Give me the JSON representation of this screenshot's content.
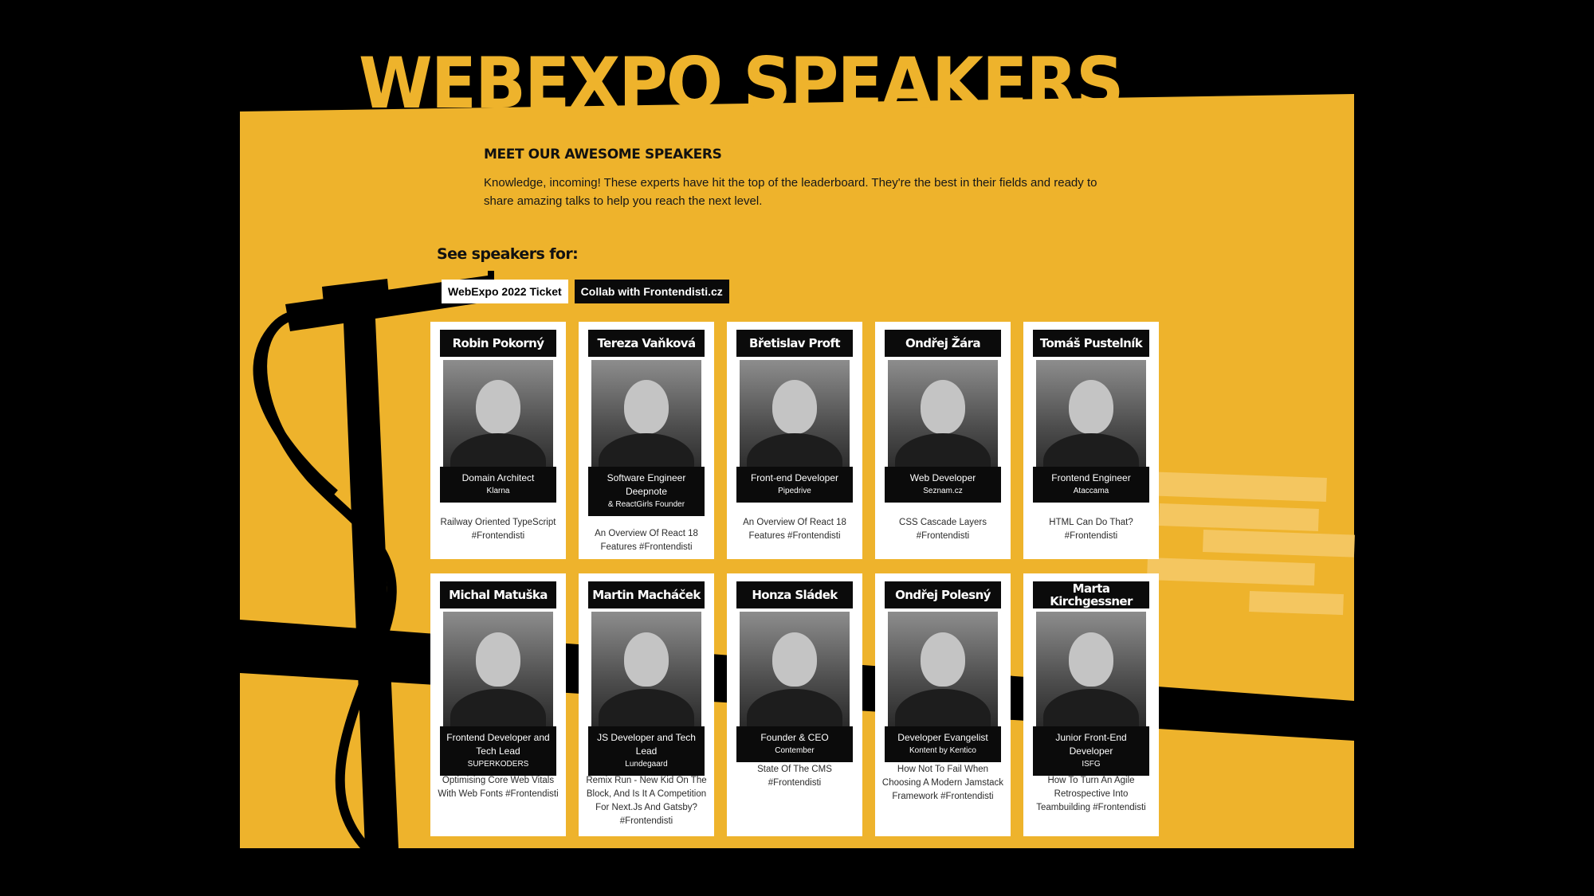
{
  "page": {
    "title": "WEBEXPO SPEAKERS"
  },
  "intro": {
    "heading": "MEET OUR AWESOME SPEAKERS",
    "text": "Knowledge, incoming! These experts have hit the top of the leaderboard. They're the best in their fields and ready to share amazing talks to help you reach the next level."
  },
  "filter": {
    "label": "See speakers for:",
    "tabs": [
      {
        "label": "WebExpo 2022 Ticket",
        "active": true
      },
      {
        "label": "Collab with Frontendisti.cz",
        "active": false
      }
    ]
  },
  "speakers": [
    {
      "name": "Robin Pokorný",
      "role": "Domain Architect",
      "company": "Klarna",
      "talk": "Railway Oriented TypeScript #Frontendisti"
    },
    {
      "name": "Tereza Vaňková",
      "role": "Software Engineer Deepnote",
      "company": "& ReactGirls Founder",
      "talk": "An Overview Of React 18 Features #Frontendisti"
    },
    {
      "name": "Břetislav Proft",
      "role": "Front-end Developer",
      "company": "Pipedrive",
      "talk": "An Overview Of React 18 Features #Frontendisti"
    },
    {
      "name": "Ondřej Žára",
      "role": "Web Developer",
      "company": "Seznam.cz",
      "talk": "CSS Cascade Layers #Frontendisti"
    },
    {
      "name": "Tomáš Pustelník",
      "role": "Frontend Engineer",
      "company": "Ataccama",
      "talk": "HTML Can Do That? #Frontendisti"
    },
    {
      "name": "Michal Matuška",
      "role": "Frontend Developer and Tech Lead",
      "company": "SUPERKODERS",
      "talk": "Optimising Core Web Vitals With Web Fonts #Frontendisti"
    },
    {
      "name": "Martin Macháček",
      "role": "JS Developer and Tech Lead",
      "company": "Lundegaard",
      "talk": "Remix Run - New Kid On The Block, And Is It A Competition For Next.Js And Gatsby? #Frontendisti"
    },
    {
      "name": "Honza Sládek",
      "role": "Founder & CEO",
      "company": "Contember",
      "talk": "State Of The CMS #Frontendisti"
    },
    {
      "name": "Ondřej Polesný",
      "role": "Developer Evangelist",
      "company": "Kontent by Kentico",
      "talk": "How Not To Fail When Choosing A Modern Jamstack Framework #Frontendisti"
    },
    {
      "name": "Marta Kirchgessner",
      "role": "Junior Front-End Developer",
      "company": "ISFG",
      "talk": "How To Turn An Agile Retrospective Into Teambuilding #Frontendisti"
    }
  ],
  "colors": {
    "accent": "#EEB32C",
    "background": "#000000",
    "card": "#FFFFFF"
  }
}
